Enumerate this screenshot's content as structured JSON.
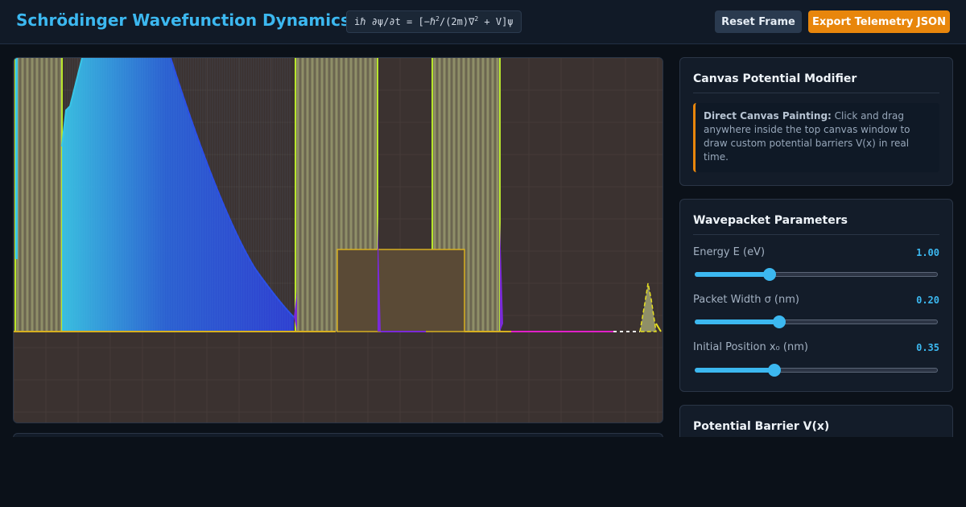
{
  "header": {
    "title": "Schrödinger Wavefunction Dynamics",
    "equation_main": "iℏ ∂ψ/∂t = [−ℏ",
    "equation_mid": "/(2m)∇",
    "equation_end": " + V]ψ",
    "equation_sup": "2",
    "reset_label": "Reset Frame",
    "export_label": "Export Telemetry JSON"
  },
  "canvas_card": {
    "title": "Canvas Potential Modifier",
    "hint_bold": "Direct Canvas Painting:",
    "hint_text": " Click and drag anywhere inside the top canvas window to draw custom potential barriers V(x) in real time."
  },
  "params": {
    "title": "Wavepacket Parameters",
    "items": [
      {
        "label": "Energy E (eV)",
        "value": "1.00",
        "fraction": 0.3
      },
      {
        "label": "Packet Width σ (nm)",
        "value": "0.20",
        "fraction": 0.34
      },
      {
        "label": "Initial Position x₀ (nm)",
        "value": "0.35",
        "fraction": 0.32
      }
    ]
  },
  "barrier_card": {
    "title": "Potential Barrier V(x)"
  },
  "colors": {
    "accent": "#3cb8f0",
    "warning": "#e8860c",
    "barrier_edge": "#b8e62c",
    "barrier_fill": "#8f8f68",
    "wave_cyan": "#38c6e8",
    "wave_blue": "#2d3fd8",
    "wave_violet": "#7a2ad8",
    "wave_magenta": "#e020c8",
    "zone_outline": "#d8b020"
  }
}
